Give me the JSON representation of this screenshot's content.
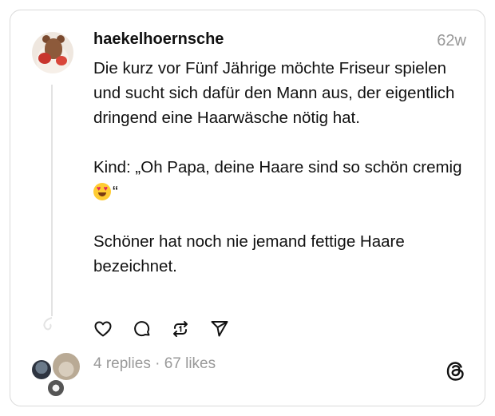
{
  "post": {
    "username": "haekelhoernsche",
    "time": "62w",
    "text_before_emoji": "Die kurz vor Fünf Jährige möchte Friseur spielen und sucht sich dafür den Mann aus, der eigentlich dringend eine Haarwäsche nötig hat.\n\nKind: „Oh Papa, deine Haare sind so schön cremig ",
    "emoji": "heart-eyes-emoji",
    "text_after_emoji": "“\n\nSchöner hat noch nie jemand fettige Haare bezeichnet.",
    "stats": "4 replies · 67 likes"
  },
  "icons": {
    "like": "heart-icon",
    "reply": "comment-icon",
    "repost": "repost-icon",
    "share": "send-icon",
    "brand": "threads-logo"
  }
}
